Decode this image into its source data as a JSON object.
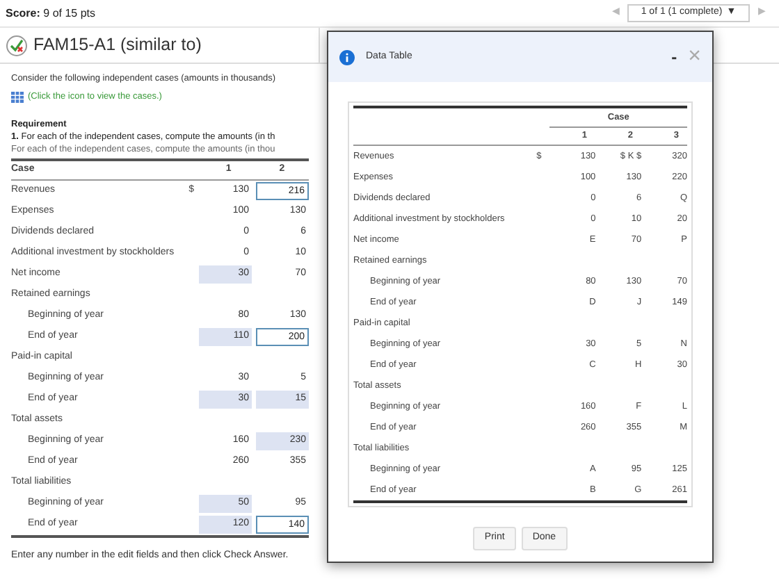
{
  "score": {
    "label": "Score:",
    "value": "9 of 15 pts"
  },
  "pager": {
    "prev": "◀",
    "text": "1 of 1 (1 complete)",
    "caret": "▼",
    "next": "▶"
  },
  "title": "FAM15-A1 (similar to)",
  "intro": "Consider the following independent cases (amounts in thousands)",
  "link": "(Click the icon to view the cases.)",
  "requirement": {
    "heading": "Requirement",
    "text": "**1.** For each of the independent cases, compute the amounts (in th",
    "clipped": "For each of the independent cases, compute the amounts (in thou"
  },
  "table": {
    "columns": [
      "Case",
      "1",
      "2"
    ],
    "rows": [
      {
        "label": "Revenues",
        "prefix": "$",
        "cells": [
          {
            "value": "130",
            "kind": "plain"
          },
          {
            "value": "216",
            "kind": "input"
          }
        ]
      },
      {
        "label": "Expenses",
        "cells": [
          {
            "value": "100",
            "kind": "plain"
          },
          {
            "value": "130",
            "kind": "plain"
          }
        ]
      },
      {
        "label": "Dividends declared",
        "cells": [
          {
            "value": "0",
            "kind": "plain"
          },
          {
            "value": "6",
            "kind": "plain"
          }
        ]
      },
      {
        "label": "Additional investment by stockholders",
        "cells": [
          {
            "value": "0",
            "kind": "plain"
          },
          {
            "value": "10",
            "kind": "plain"
          }
        ]
      },
      {
        "label": "Net income",
        "cells": [
          {
            "value": "30",
            "kind": "shaded"
          },
          {
            "value": "70",
            "kind": "plain"
          }
        ]
      },
      {
        "label": "Retained earnings",
        "children": [
          {
            "label": "Beginning of year",
            "cells": [
              {
                "value": "80",
                "kind": "plain"
              },
              {
                "value": "130",
                "kind": "plain"
              }
            ]
          },
          {
            "label": "End of year",
            "cells": [
              {
                "value": "110",
                "kind": "shaded"
              },
              {
                "value": "200",
                "kind": "input"
              }
            ]
          }
        ]
      },
      {
        "label": "Paid-in capital",
        "children": [
          {
            "label": "Beginning of year",
            "cells": [
              {
                "value": "30",
                "kind": "plain"
              },
              {
                "value": "5",
                "kind": "plain"
              }
            ]
          },
          {
            "label": "End of year",
            "cells": [
              {
                "value": "30",
                "kind": "shaded"
              },
              {
                "value": "15",
                "kind": "shaded"
              }
            ]
          }
        ]
      },
      {
        "label": "Total assets",
        "children": [
          {
            "label": "Beginning of year",
            "cells": [
              {
                "value": "160",
                "kind": "plain"
              },
              {
                "value": "230",
                "kind": "shaded"
              }
            ]
          },
          {
            "label": "End of year",
            "cells": [
              {
                "value": "260",
                "kind": "plain"
              },
              {
                "value": "355",
                "kind": "plain"
              }
            ]
          }
        ]
      },
      {
        "label": "Total liabilities",
        "children": [
          {
            "label": "Beginning of year",
            "cells": [
              {
                "value": "50",
                "kind": "shaded"
              },
              {
                "value": "95",
                "kind": "plain"
              }
            ]
          },
          {
            "label": "End of year",
            "cells": [
              {
                "value": "120",
                "kind": "shaded"
              },
              {
                "value": "140",
                "kind": "input"
              }
            ]
          }
        ]
      }
    ]
  },
  "footer": "Enter any number in the edit fields and then click Check Answer.",
  "dialog": {
    "title": "Data Table",
    "minimize": "-",
    "close": "×",
    "group_header": "Case",
    "columns": [
      "1",
      "2",
      "3"
    ],
    "rows": [
      {
        "label": "Revenues",
        "cells": [
          "$",
          "130",
          "$ K $",
          "320"
        ]
      },
      {
        "label": "Expenses",
        "cells": [
          "",
          "100",
          "130",
          "220"
        ]
      },
      {
        "label": "Dividends declared",
        "cells": [
          "",
          "0",
          "6",
          "Q"
        ]
      },
      {
        "label": "Additional investment by stockholders",
        "cells": [
          "",
          "0",
          "10",
          "20"
        ]
      },
      {
        "label": "Net income",
        "cells": [
          "",
          "E",
          "70",
          "P"
        ]
      },
      {
        "label": "Retained earnings",
        "children": [
          {
            "label": "Beginning of year",
            "cells": [
              "",
              "80",
              "130",
              "70"
            ]
          },
          {
            "label": "End of year",
            "cells": [
              "",
              "D",
              "J",
              "149"
            ]
          }
        ]
      },
      {
        "label": "Paid-in capital",
        "children": [
          {
            "label": "Beginning of year",
            "cells": [
              "",
              "30",
              "5",
              "N"
            ]
          },
          {
            "label": "End of year",
            "cells": [
              "",
              "C",
              "H",
              "30"
            ]
          }
        ]
      },
      {
        "label": "Total assets",
        "children": [
          {
            "label": "Beginning of year",
            "cells": [
              "",
              "160",
              "F",
              "L"
            ]
          },
          {
            "label": "End of year",
            "cells": [
              "",
              "260",
              "355",
              "M"
            ]
          }
        ]
      },
      {
        "label": "Total liabilities",
        "children": [
          {
            "label": "Beginning of year",
            "cells": [
              "",
              "A",
              "95",
              "125"
            ]
          },
          {
            "label": "End of year",
            "cells": [
              "",
              "B",
              "G",
              "261"
            ]
          }
        ]
      }
    ],
    "buttons": [
      "Print",
      "Done"
    ]
  }
}
